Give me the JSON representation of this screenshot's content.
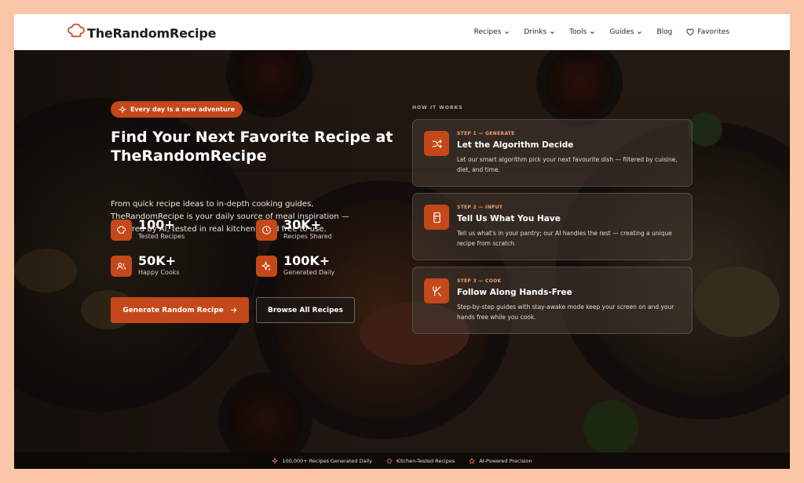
{
  "brand": {
    "name": "TheRandomRecipe",
    "accent": "#c4481a"
  },
  "nav": {
    "items": [
      {
        "label": "Recipes",
        "dropdown": true
      },
      {
        "label": "Drinks",
        "dropdown": true
      },
      {
        "label": "Tools",
        "dropdown": true
      },
      {
        "label": "Guides",
        "dropdown": true
      },
      {
        "label": "Blog",
        "dropdown": false
      }
    ],
    "favorites": "Favorites"
  },
  "hero": {
    "badge": "Every day is a new adventure",
    "title": "Find Your Next Favorite Recipe at TheRandomRecipe",
    "description": "From quick recipe ideas to in-depth cooking guides, TheRandomRecipe is your daily source of meal inspiration — powered by AI, tested in real kitchens, and free to use.",
    "stats": [
      {
        "value": "100+",
        "label": "Tested Recipes",
        "icon": "chef-hat-icon"
      },
      {
        "value": "30K+",
        "label": "Recipes Shared",
        "icon": "clock-icon"
      },
      {
        "value": "50K+",
        "label": "Happy Cooks",
        "icon": "users-icon"
      },
      {
        "value": "100K+",
        "label": "Generated Daily",
        "icon": "sparkles-icon"
      }
    ],
    "primary_button": "Generate Random Recipe",
    "secondary_button": "Browse All Recipes"
  },
  "how_it_works": {
    "heading": "HOW IT WORKS",
    "steps": [
      {
        "kicker": "STEP 1 — GENERATE",
        "title": "Let the Algorithm Decide",
        "description": "Let our smart algorithm pick your next favourite dish — filtered by cuisine, diet, and time.",
        "icon": "shuffle-icon"
      },
      {
        "kicker": "STEP 2 — INPUT",
        "title": "Tell Us What You Have",
        "description": "Tell us what's in your pantry; our AI handles the rest — creating a unique recipe from scratch.",
        "icon": "fridge-icon"
      },
      {
        "kicker": "STEP 3 — COOK",
        "title": "Follow Along Hands-Free",
        "description": "Step-by-step guides with stay-awake mode keep your screen on and your hands free while you cook.",
        "icon": "utensils-icon"
      }
    ]
  },
  "footer_strip": [
    {
      "label": "100,000+ Recipes Generated Daily",
      "icon": "sparkles-icon"
    },
    {
      "label": "Kitchen-Tested Recipes",
      "icon": "chef-hat-icon"
    },
    {
      "label": "AI-Powered Precision",
      "icon": "star-icon"
    }
  ]
}
